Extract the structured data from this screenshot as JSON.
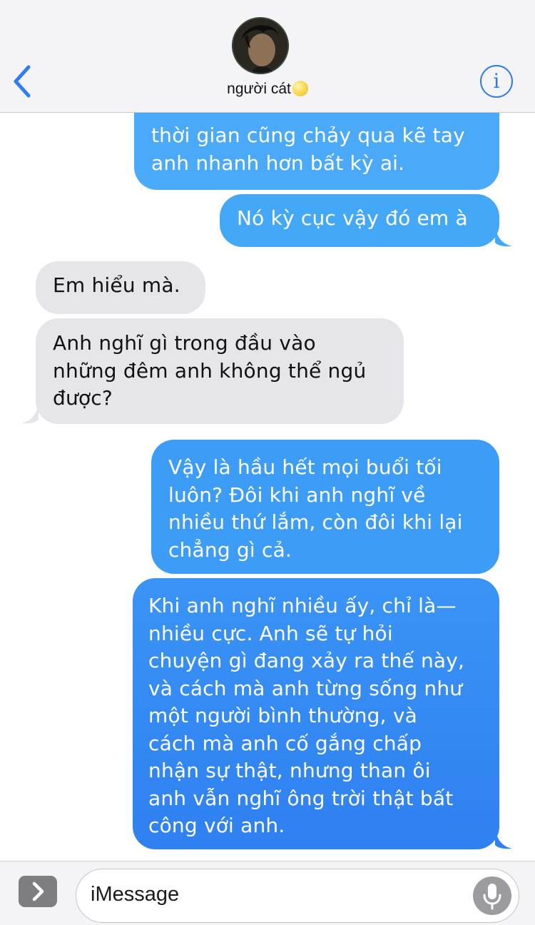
{
  "header": {
    "contact_name": "người cát",
    "back_icon": "chevron-left-icon",
    "info_icon": "info-icon",
    "accent_color": "#2f7bf3"
  },
  "messages": [
    {
      "side": "sent",
      "text": "thời gian cũng chảy qua kẽ tay\nanh nhanh hơn bất kỳ ai."
    },
    {
      "side": "sent",
      "text": "Nó kỳ cục vậy đó em à"
    },
    {
      "side": "received",
      "text": "Em hiểu mà."
    },
    {
      "side": "received",
      "text": "Anh nghĩ gì trong đầu vào\nnhững đêm anh không thể ngủ\nđược?"
    },
    {
      "side": "sent",
      "text": "Vậy là hầu hết mọi buổi tối\nluôn? Đôi khi anh nghĩ về\nnhiều thứ lắm, còn đôi khi lại\nchẳng gì cả."
    },
    {
      "side": "sent",
      "text": "Khi anh nghĩ nhiều ấy, chỉ là—\nnhiều cực. Anh sẽ tự hỏi\nchuyện gì đang xảy ra thế này,\nvà cách mà anh từng sống như\nmột người bình thường, và\ncách mà anh cố gắng chấp\nnhận sự thật, nhưng than ôi\nanh vẫn nghĩ ông trời thật bất\ncông với anh."
    }
  ],
  "colors": {
    "sent_bubble": "#3d9cf6",
    "received_bubble": "#e6e5ea"
  },
  "input": {
    "placeholder": "iMessage",
    "expand_icon": "chevron-right-icon",
    "mic_icon": "microphone-icon"
  }
}
